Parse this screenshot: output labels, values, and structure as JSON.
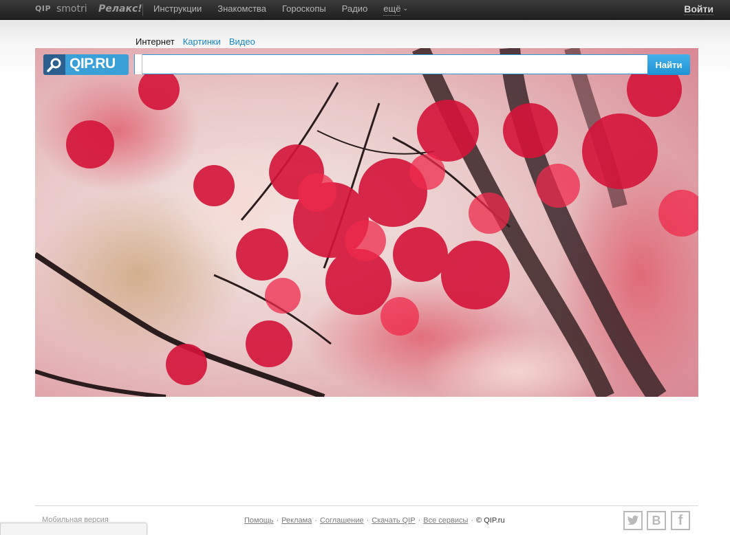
{
  "topbar": {
    "brands": [
      "QIP",
      "smotri",
      "Релакс!"
    ],
    "nav": [
      "Инструкции",
      "Знакомства",
      "Гороскопы",
      "Радио",
      "ещё"
    ],
    "login": "Войти"
  },
  "search": {
    "tabs": {
      "internet": "Интернет",
      "images": "Картинки",
      "video": "Видео"
    },
    "logo_text": "QIP.RU",
    "input_value": "",
    "button": "Найти"
  },
  "footer": {
    "mobile": "Мобильная версия",
    "links": [
      "Помощь",
      "Реклама",
      "Соглашение",
      "Скачать QIP",
      "Все сервисы"
    ],
    "copyright": "© QIP.ru",
    "social": {
      "twitter": "twitter-icon",
      "vk": "В",
      "facebook": "f"
    }
  },
  "colors": {
    "accent": "#2c9ad6",
    "topbar": "#2a2a2a",
    "link": "#1a86c6"
  }
}
